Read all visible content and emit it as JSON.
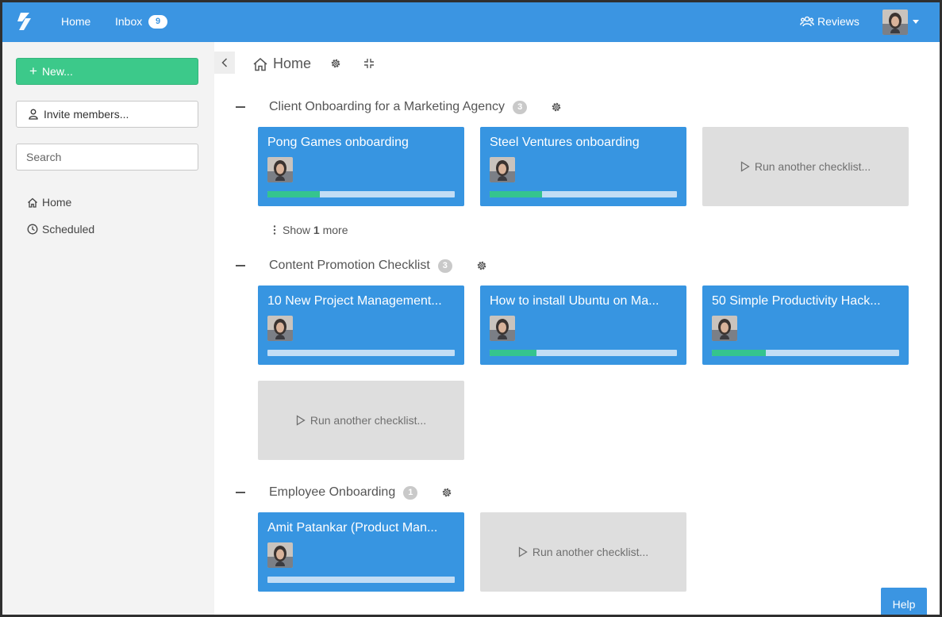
{
  "topbar": {
    "home_label": "Home",
    "inbox_label": "Inbox",
    "inbox_count": "9",
    "reviews_label": "Reviews"
  },
  "sidebar": {
    "new_label": "New...",
    "invite_label": "Invite members...",
    "search_placeholder": "Search",
    "items": [
      {
        "label": "Home",
        "icon": "home-icon"
      },
      {
        "label": "Scheduled",
        "icon": "clock-icon"
      }
    ]
  },
  "breadcrumb": {
    "label": "Home"
  },
  "sections": [
    {
      "title": "Client Onboarding for a Marketing Agency",
      "count": "3",
      "cards": [
        {
          "title": "Pong Games onboarding",
          "progress": 0.28
        },
        {
          "title": "Steel Ventures onboarding",
          "progress": 0.28
        }
      ],
      "run_label": "Run another checklist...",
      "show_more": {
        "prefix": "Show",
        "count": "1",
        "suffix": "more"
      }
    },
    {
      "title": "Content Promotion Checklist",
      "count": "3",
      "cards": [
        {
          "title": "10 New Project Management...",
          "progress": 0
        },
        {
          "title": "How to install Ubuntu on Ma...",
          "progress": 0.25
        },
        {
          "title": "50 Simple Productivity Hack...",
          "progress": 0.29
        }
      ],
      "run_label": "Run another checklist..."
    },
    {
      "title": "Employee Onboarding",
      "count": "1",
      "cards": [
        {
          "title": "Amit Patankar (Product Man...",
          "progress": 0
        }
      ],
      "run_label": "Run another checklist..."
    }
  ],
  "help_label": "Help",
  "colors": {
    "topbar": "#3b95e2",
    "card": "#3795e1",
    "progress_fill": "#35c48e",
    "new_button": "#3cc98a"
  }
}
